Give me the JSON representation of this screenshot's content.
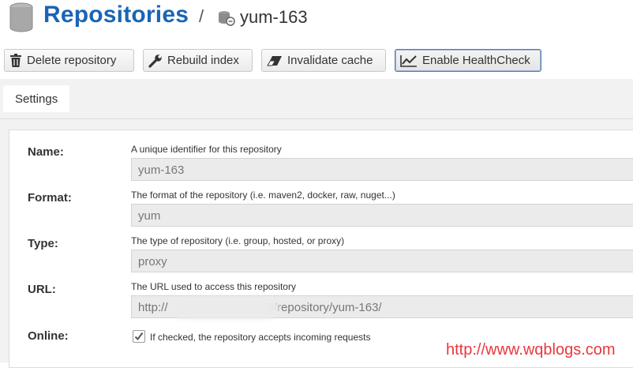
{
  "header": {
    "title": "Repositories",
    "separator": "/",
    "repo_name": "yum-163"
  },
  "toolbar": {
    "delete_label": "Delete repository",
    "rebuild_label": "Rebuild index",
    "invalidate_label": "Invalidate cache",
    "healthcheck_label": "Enable HealthCheck"
  },
  "tabs": [
    {
      "label": "Settings"
    }
  ],
  "form": {
    "name": {
      "label": "Name:",
      "help": "A unique identifier for this repository",
      "value": "yum-163"
    },
    "format": {
      "label": "Format:",
      "help": "The format of the repository (i.e. maven2, docker, raw, nuget...)",
      "value": "yum"
    },
    "type": {
      "label": "Type:",
      "help": "The type of repository (i.e. group, hosted, or proxy)",
      "value": "proxy"
    },
    "url": {
      "label": "URL:",
      "help": "The URL used to access this repository",
      "value_prefix": "http://",
      "value_suffix": "9/repository/yum-163/"
    },
    "online": {
      "label": "Online:",
      "checkbox_label": "If checked, the repository accepts incoming requests",
      "checked": true
    }
  },
  "watermark": "http://www.wqblogs.com",
  "colors": {
    "title": "#1a65b5",
    "watermark": "#e8383b"
  }
}
